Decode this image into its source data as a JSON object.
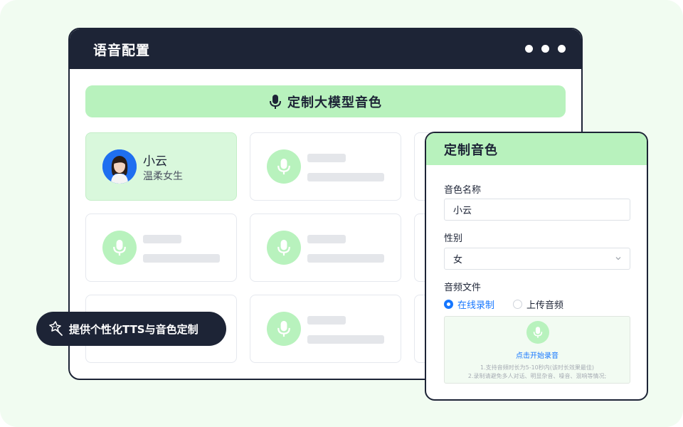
{
  "window": {
    "title": "语音配置",
    "custom_button_label": "定制大模型音色"
  },
  "voices": [
    {
      "name": "小云",
      "desc": "温柔女生"
    }
  ],
  "tag": {
    "label": "提供个性化TTS与音色定制"
  },
  "panel": {
    "title": "定制音色",
    "name_label": "音色名称",
    "name_value": "小云",
    "gender_label": "性别",
    "gender_value": "女",
    "file_label": "音频文件",
    "options": [
      "在线录制",
      "上传音频"
    ],
    "record_label": "点击开始录音",
    "tips": [
      "1.支持音频时长为5-10秒内(该时长效果最佳)",
      "2.录制请避免多人对话、明显杂音、噪音、混响等情况;"
    ]
  },
  "colors": {
    "accent": "#b8f2bd",
    "dark": "#1d2436",
    "link": "#1677ff",
    "background": "#f1fcf1"
  }
}
